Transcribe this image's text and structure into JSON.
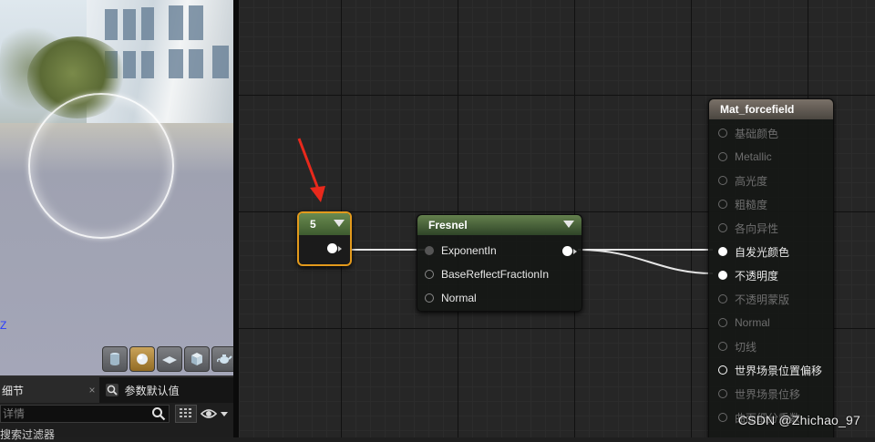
{
  "viewport": {
    "axis_label": "Z",
    "toolbar": [
      {
        "name": "cylinder-preview-button",
        "icon": "cylinder-icon"
      },
      {
        "name": "sphere-preview-button",
        "icon": "sphere-icon",
        "active": true
      },
      {
        "name": "plane-preview-button",
        "icon": "plane-icon"
      },
      {
        "name": "cube-preview-button",
        "icon": "cube-icon"
      },
      {
        "name": "custom-mesh-preview-button",
        "icon": "teapot-icon"
      }
    ]
  },
  "panel": {
    "tab_details": "细节",
    "tab_details_close": "×",
    "tab_params": "参数默认值",
    "search_placeholder": "详情",
    "filter_text": "搜索过滤器"
  },
  "nodes": {
    "constant": {
      "value": "5"
    },
    "fresnel": {
      "title": "Fresnel",
      "inputs": [
        "ExponentIn",
        "BaseReflectFractionIn",
        "Normal"
      ]
    },
    "material": {
      "title": "Mat_forcefield",
      "inputs": [
        {
          "label": "基础颜色",
          "state": "dim"
        },
        {
          "label": "Metallic",
          "state": "dim"
        },
        {
          "label": "高光度",
          "state": "dim"
        },
        {
          "label": "粗糙度",
          "state": "dim"
        },
        {
          "label": "各向异性",
          "state": "dim"
        },
        {
          "label": "自发光颜色",
          "state": "connected"
        },
        {
          "label": "不透明度",
          "state": "connected"
        },
        {
          "label": "不透明蒙版",
          "state": "dim"
        },
        {
          "label": "Normal",
          "state": "dim"
        },
        {
          "label": "切线",
          "state": "dim"
        },
        {
          "label": "世界场景位置偏移",
          "state": "active"
        },
        {
          "label": "世界场景位移",
          "state": "dim"
        },
        {
          "label": "曲面细分乘数",
          "state": "dim"
        }
      ]
    }
  },
  "colors": {
    "selection_outline": "#e39a1c",
    "annotation_arrow": "#e8291c",
    "expression_header": "#64804d",
    "result_header": "#7a7168"
  },
  "watermark": "CSDN @Zhichao_97"
}
